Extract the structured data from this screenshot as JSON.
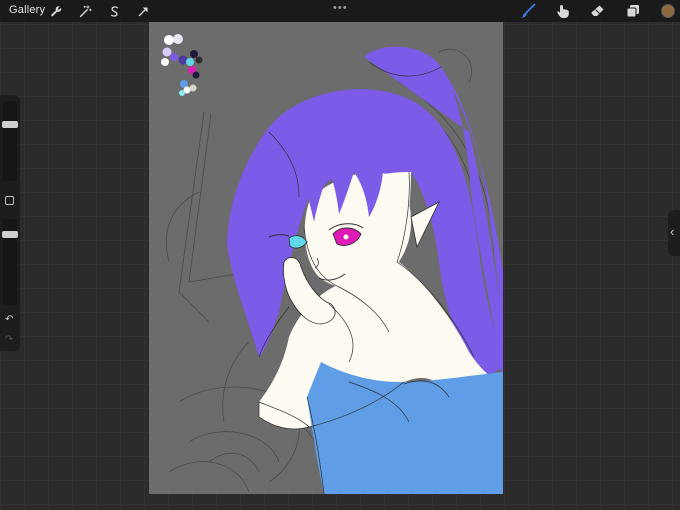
{
  "topbar": {
    "gallery_label": "Gallery",
    "tools_left": [
      "wrench-icon",
      "magic-wand-icon",
      "selection-s-icon",
      "transform-arrow-icon"
    ],
    "more_indicator": "•••",
    "tools_right": [
      "brush-icon",
      "smudge-icon",
      "eraser-icon",
      "layers-icon"
    ],
    "current_color": "#8c6a3f",
    "brush_active_color": "#3b7be8"
  },
  "sidebar": {
    "brush_size_level": 0.72,
    "opacity_level": 0.85,
    "undo_glyph": "↶",
    "redo_glyph": "↷"
  },
  "right_panel": {
    "toggle_glyph": "‹"
  },
  "canvas": {
    "background": "#6c6c6c",
    "colors": {
      "hair": "#7b5be8",
      "skin": "#fdfaf2",
      "dress": "#5f9ee6",
      "eye_left": "#5fd8e8",
      "eye_right": "#e01ab6",
      "line": "#2e2e2e"
    },
    "palette": [
      "#ffffff",
      "#d8ccff",
      "#7b5be8",
      "#4a3aa0",
      "#1d1a3a",
      "#5fd8e8",
      "#8fe8f0",
      "#e01ab6",
      "#5f9ee6",
      "#2e2e2e",
      "#d9d2c8"
    ]
  }
}
